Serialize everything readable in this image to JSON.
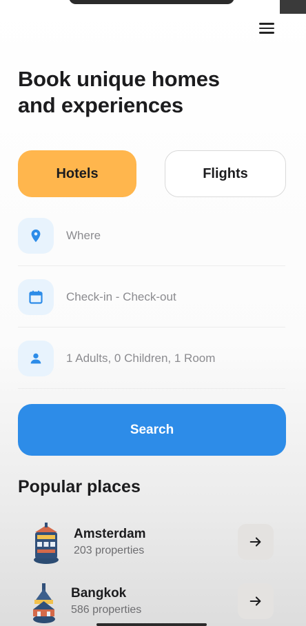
{
  "header": {
    "menu_icon": "hamburger-menu-icon",
    "headline_line1": "Book unique homes",
    "headline_line2": "and experiences"
  },
  "tabs": [
    {
      "label": "Hotels",
      "selected": true
    },
    {
      "label": "Flights",
      "selected": false
    }
  ],
  "form": {
    "where": {
      "placeholder": "Where",
      "icon": "location-pin-icon"
    },
    "dates": {
      "placeholder": "Check-in - Check-out",
      "icon": "calendar-icon"
    },
    "guests": {
      "value": "1 Adults, 0 Children, 1 Room",
      "icon": "person-icon"
    },
    "search_label": "Search"
  },
  "popular": {
    "title": "Popular places",
    "places": [
      {
        "name": "Amsterdam",
        "count": "203 properties",
        "icon": "arrow-right-icon"
      },
      {
        "name": "Bangkok",
        "count": "586 properties",
        "icon": "arrow-right-icon"
      }
    ]
  },
  "colors": {
    "accent_orange": "#ffb64d",
    "primary_blue": "#2d8ce8",
    "icon_bg": "#e8f3fd"
  }
}
